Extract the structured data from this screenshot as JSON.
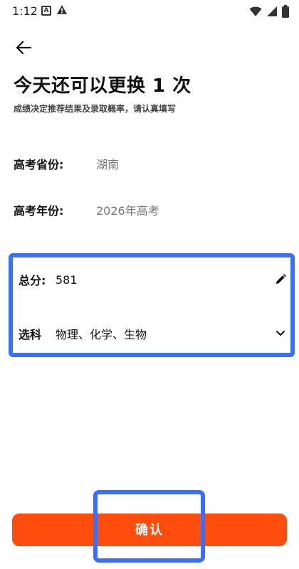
{
  "status_bar": {
    "time": "1:12",
    "app_icon_letter": "A"
  },
  "header": {
    "title": "今天还可以更换 1 次",
    "subtitle": "成绩决定推荐结果及录取概率，请认真填写"
  },
  "info": {
    "province_label": "高考省份:",
    "province_value": "湖南",
    "year_label": "高考年份:",
    "year_value": "2026年高考"
  },
  "edit": {
    "score_label": "总分:",
    "score_value": "581",
    "subject_label": "选科",
    "subject_value": "物理、化学、生物"
  },
  "actions": {
    "confirm_label": "确认"
  },
  "colors": {
    "accent": "#ff4d0d",
    "highlight": "#3b6ff5"
  }
}
